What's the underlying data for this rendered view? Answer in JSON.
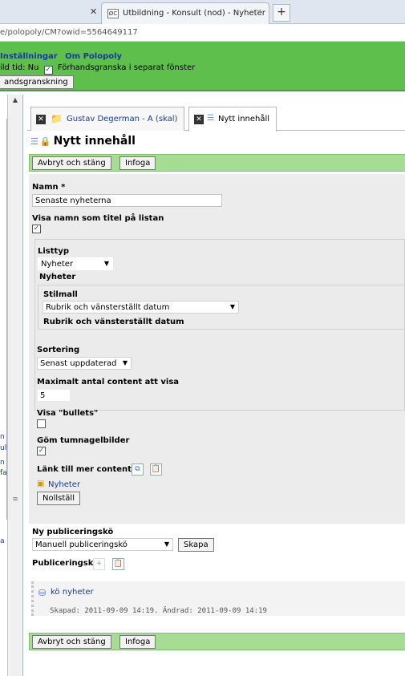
{
  "browser": {
    "tab_title": "Utbildning - Konsult (nod) - Nyheter",
    "favicon": "ØC",
    "url": "e/polopoly/CM?owid=5564649117"
  },
  "header": {
    "menu": [
      "Inställningar",
      "Om Polopoly"
    ],
    "timeline_label": "ild tid: Nu",
    "preview_window_label": "Förhandsgranska i separat fönster",
    "preview_checked": true,
    "preview_button": "andsgranskning"
  },
  "sidebar": {
    "fragments": [
      "n",
      "ult",
      "n",
      "fa",
      "a"
    ]
  },
  "tabs": [
    {
      "label": "Gustav Degerman - A (skal)"
    },
    {
      "label": "Nytt innehåll"
    }
  ],
  "page": {
    "title": "Nytt innehåll"
  },
  "actions": {
    "cancel": "Avbryt och stäng",
    "insert": "Infoga"
  },
  "form": {
    "name_label": "Namn *",
    "name_value": "Senaste nyheterna",
    "show_name_label": "Visa namn som titel på listan",
    "show_name_checked": true,
    "list_type_label": "Listtyp",
    "list_type_value": "Nyheter",
    "news_heading": "Nyheter",
    "stylesheet_label": "Stilmall",
    "stylesheet_value": "Rubrik och vänsterställt datum",
    "stylesheet_preview": "Rubrik och vänsterställt datum",
    "sort_label": "Sortering",
    "sort_value": "Senast uppdaterad",
    "max_label": "Maximalt antal content att visa",
    "max_value": "5",
    "bullets_label": "Visa \"bullets\"",
    "bullets_checked": false,
    "hide_thumbs_label": "Göm tumnagelbilder",
    "hide_thumbs_checked": true,
    "link_more_label": "Länk till mer content",
    "link_target": "Nyheter",
    "reset_button": "Nollställ",
    "new_queue_label": "Ny publiceringskö",
    "queue_select_value": "Manuell publiceringskö",
    "create_button": "Skapa",
    "queue_label": "Publiceringskö",
    "queue_item": "kö nyheter",
    "queue_meta": "Skapad: 2011-09-09 14:19. Ändrad: 2011-09-09 14:19"
  },
  "colors": {
    "header_green": "#5fbf4c",
    "toolbar_green": "#a6dc94",
    "link_blue": "#173d8f"
  }
}
